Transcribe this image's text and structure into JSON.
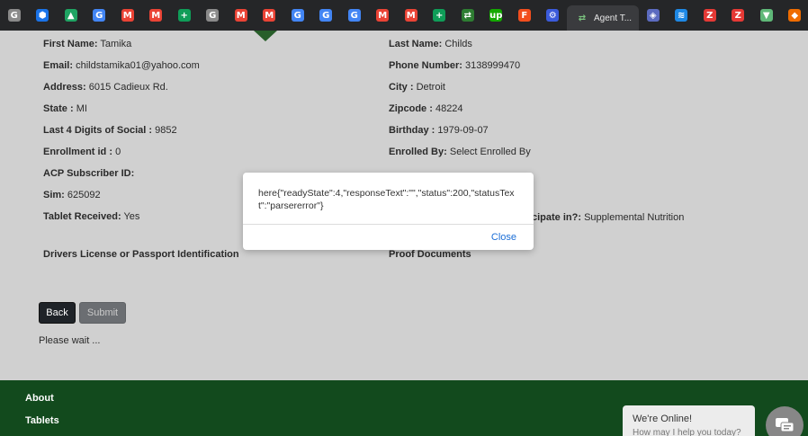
{
  "browser": {
    "tabs": [
      {
        "icon": "g-docs-gray-icon",
        "glyph": "G",
        "color": "#8a8a8a"
      },
      {
        "icon": "blue-hex-icon",
        "glyph": "⬢",
        "color": "#1a73e8"
      },
      {
        "icon": "google-drive-icon",
        "glyph": "▲",
        "color": "#1fa463"
      },
      {
        "icon": "google-icon",
        "glyph": "G",
        "color": "#4285f4"
      },
      {
        "icon": "gmail-icon",
        "glyph": "M",
        "color": "#ea4335"
      },
      {
        "icon": "gmail-icon",
        "glyph": "M",
        "color": "#ea4335"
      },
      {
        "icon": "sheets-plus-icon",
        "glyph": "+",
        "color": "#0f9d58"
      },
      {
        "icon": "g-gray-icon",
        "glyph": "G",
        "color": "#8a8a8a"
      },
      {
        "icon": "gmail-icon",
        "glyph": "M",
        "color": "#ea4335"
      },
      {
        "icon": "gmail-icon",
        "glyph": "M",
        "color": "#ea4335"
      },
      {
        "icon": "google-icon",
        "glyph": "G",
        "color": "#4285f4"
      },
      {
        "icon": "google-icon",
        "glyph": "G",
        "color": "#4285f4"
      },
      {
        "icon": "google-icon",
        "glyph": "G",
        "color": "#4285f4"
      },
      {
        "icon": "gmail-icon",
        "glyph": "M",
        "color": "#ea4335"
      },
      {
        "icon": "gmail-icon",
        "glyph": "M",
        "color": "#ea4335"
      },
      {
        "icon": "sheets-plus-icon",
        "glyph": "+",
        "color": "#0f9d58"
      },
      {
        "icon": "green-arrows-icon",
        "glyph": "⇄",
        "color": "#2e7d32"
      },
      {
        "icon": "upwork-icon",
        "glyph": "up",
        "color": "#14a800"
      },
      {
        "icon": "figma-icon",
        "glyph": "F",
        "color": "#f24e1e"
      },
      {
        "icon": "blue-tool-icon",
        "glyph": "⚙",
        "color": "#3b5bdb"
      }
    ],
    "active_tab": {
      "title": "Agent T...",
      "icon": "agent-tool-icon"
    },
    "tabs_after": [
      {
        "icon": "cube-icon",
        "glyph": "◈",
        "color": "#5c6bc0"
      },
      {
        "icon": "blue-wave-icon",
        "glyph": "≋",
        "color": "#1e88e5"
      },
      {
        "icon": "zotero-icon",
        "glyph": "Z",
        "color": "#e53935"
      },
      {
        "icon": "zotero-icon",
        "glyph": "Z",
        "color": "#e53935"
      },
      {
        "icon": "vuetify-icon",
        "glyph": "▼",
        "color": "#5fb878"
      },
      {
        "icon": "orange-box-icon",
        "glyph": "◆",
        "color": "#ef6c00"
      }
    ]
  },
  "form": {
    "left": [
      {
        "label": "First Name:",
        "value": "Tamika"
      },
      {
        "label": "Email:",
        "value": "childstamika01@yahoo.com"
      },
      {
        "label": "Address:",
        "value": "6015 Cadieux Rd."
      },
      {
        "label": "State :",
        "value": "MI"
      },
      {
        "label": "Last 4 Digits of Social :",
        "value": "9852"
      },
      {
        "label": "Enrollment id :",
        "value": "0"
      },
      {
        "label": "ACP Subscriber ID:",
        "value": ""
      },
      {
        "label": "Sim:",
        "value": "625092"
      },
      {
        "label": "Tablet Received:",
        "value": "Yes"
      }
    ],
    "right": [
      {
        "label": "Last Name:",
        "value": "Childs"
      },
      {
        "label": "Phone Number:",
        "value": "3138999470"
      },
      {
        "label": "City :",
        "value": "Detroit"
      },
      {
        "label": "Zipcode :",
        "value": "48224"
      },
      {
        "label": "Birthday :",
        "value": "1979-09-07"
      },
      {
        "label": "Enrolled By:",
        "value": "Select Enrolled By"
      }
    ],
    "partial_right_label": "cipate in?:",
    "partial_right_value": "Supplemental Nutrition",
    "section_left": "Drivers License or Passport Identification",
    "section_right": "Proof Documents",
    "back_label": "Back",
    "submit_label": "Submit",
    "wait_text": "Please wait ..."
  },
  "modal": {
    "message": "here{\"readyState\":4,\"responseText\":\"\",\"status\":200,\"statusText\":\"parsererror\"}",
    "close_label": "Close"
  },
  "footer": {
    "links": [
      "About",
      "Tablets"
    ]
  },
  "chat_widget": {
    "title": "We're Online!",
    "subtitle": "How may I help you today?"
  },
  "colors": {
    "footer_green": "#124a1d",
    "link_blue": "#1a6dd6",
    "overlay_gray": "#d0d0d0"
  }
}
